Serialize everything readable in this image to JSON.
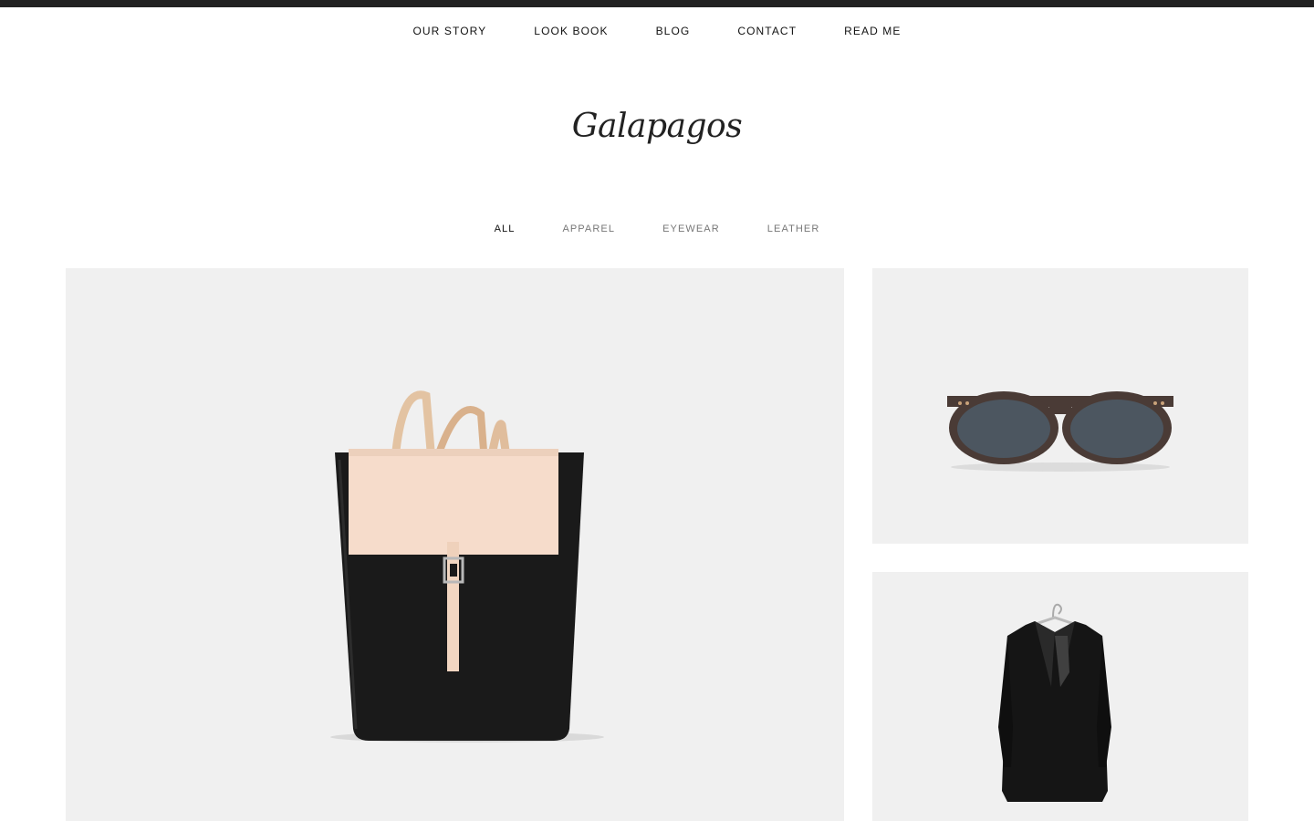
{
  "nav": {
    "items": [
      {
        "label": "OUR STORY"
      },
      {
        "label": "LOOK BOOK"
      },
      {
        "label": "BLOG"
      },
      {
        "label": "CONTACT"
      },
      {
        "label": "READ ME"
      }
    ]
  },
  "site": {
    "title": "Galapagos"
  },
  "filters": {
    "items": [
      {
        "label": "ALL",
        "active": true
      },
      {
        "label": "APPAREL",
        "active": false
      },
      {
        "label": "EYEWEAR",
        "active": false
      },
      {
        "label": "LEATHER",
        "active": false
      }
    ]
  },
  "products": [
    {
      "icon": "backpack-image"
    },
    {
      "icon": "sunglasses-image"
    },
    {
      "icon": "blazer-image"
    }
  ],
  "colors": {
    "top_bar": "#222222",
    "tile_background": "#f0f0f0",
    "text_active": "#111111",
    "text_muted": "#777777"
  }
}
